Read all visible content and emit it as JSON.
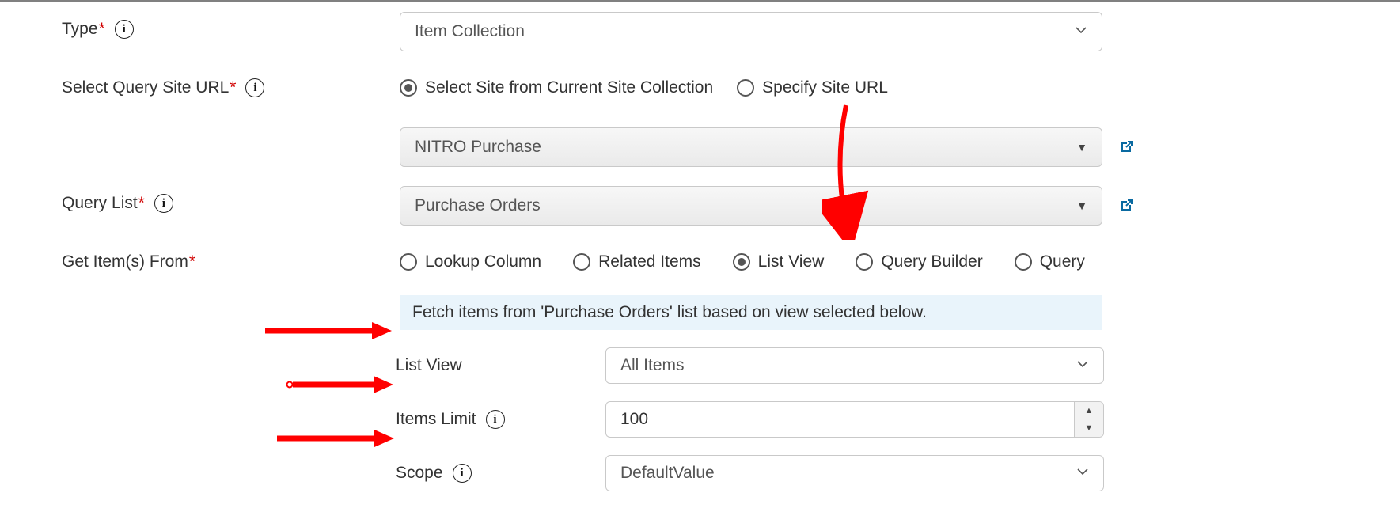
{
  "labels": {
    "type": "Type",
    "site_url": "Select Query Site URL",
    "query_list": "Query List",
    "get_items": "Get Item(s) From",
    "list_view": "List View",
    "items_limit": "Items Limit",
    "scope": "Scope"
  },
  "type_select": {
    "value": "Item Collection"
  },
  "site_options": {
    "current": "Select Site from Current Site Collection",
    "specify": "Specify Site URL",
    "selected": "current",
    "site_value": "NITRO Purchase"
  },
  "query_list_select": {
    "value": "Purchase Orders"
  },
  "get_items_options": {
    "lookup": "Lookup Column",
    "related": "Related Items",
    "listview": "List View",
    "builder": "Query Builder",
    "query": "Query",
    "selected": "listview"
  },
  "helper_text": "Fetch items from 'Purchase Orders' list based on view selected below.",
  "list_view_select": {
    "value": "All Items"
  },
  "items_limit_value": "100",
  "scope_select": {
    "value": "DefaultValue"
  }
}
